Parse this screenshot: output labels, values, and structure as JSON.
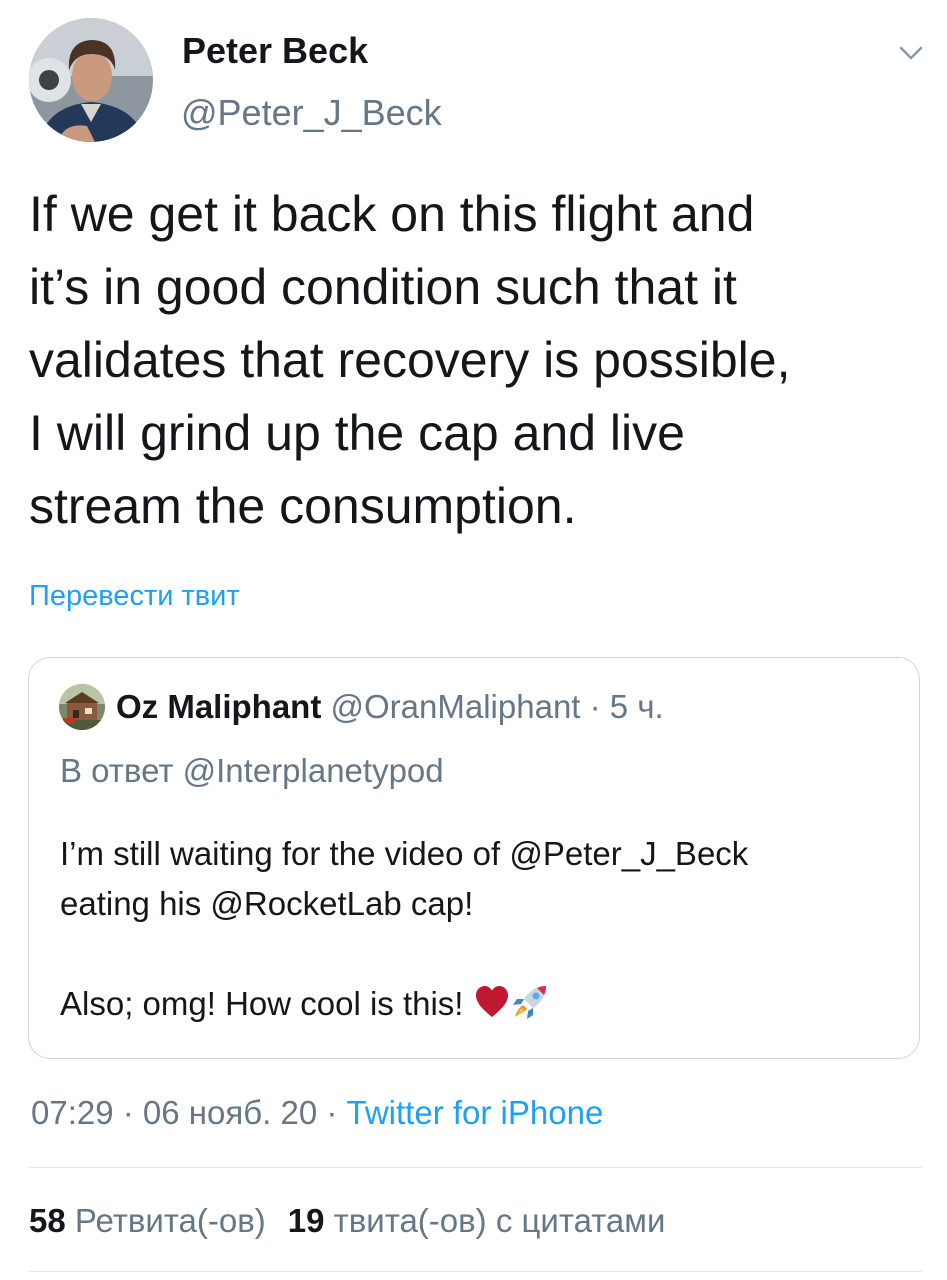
{
  "author": {
    "name": "Peter Beck",
    "handle": "@Peter_J_Beck"
  },
  "tweet": {
    "lines": [
      "If we get it back on this flight and",
      "it’s in good condition such that it",
      "validates that recovery is possible,",
      "I will grind up the cap and live",
      "stream the consumption."
    ],
    "translate_label": "Перевести твит"
  },
  "quoted": {
    "name": "Oz Maliphant",
    "handle": "@OranMaliphant",
    "separator": " · ",
    "time": "5 ч.",
    "reply_prefix": "В ответ ",
    "reply_to": "@Interplanetypod",
    "body_line_1": "I’m still waiting for the video of @Peter_J_Beck",
    "body_line_2": "eating his @RocketLab cap!",
    "body_line_3": "Also; omg! How cool is this! ",
    "emojis": [
      "heart-emoji",
      "rocket-emoji"
    ]
  },
  "meta": {
    "time": "07:29",
    "sep1": " · ",
    "date": "06 нояб. 20",
    "sep2": " · ",
    "source": "Twitter for iPhone"
  },
  "stats": {
    "retweets_count": "58",
    "retweets_label": " Ретвита(-ов)",
    "quotes_count": "19",
    "quotes_label": " твита(-ов) с цитатами"
  },
  "colors": {
    "text": "#14171a",
    "secondary": "#657786",
    "link": "#1da1f2",
    "border": "#ccd6dd",
    "divider": "#e1e8ed"
  },
  "icons": {
    "caret": "chevron-down-icon"
  }
}
